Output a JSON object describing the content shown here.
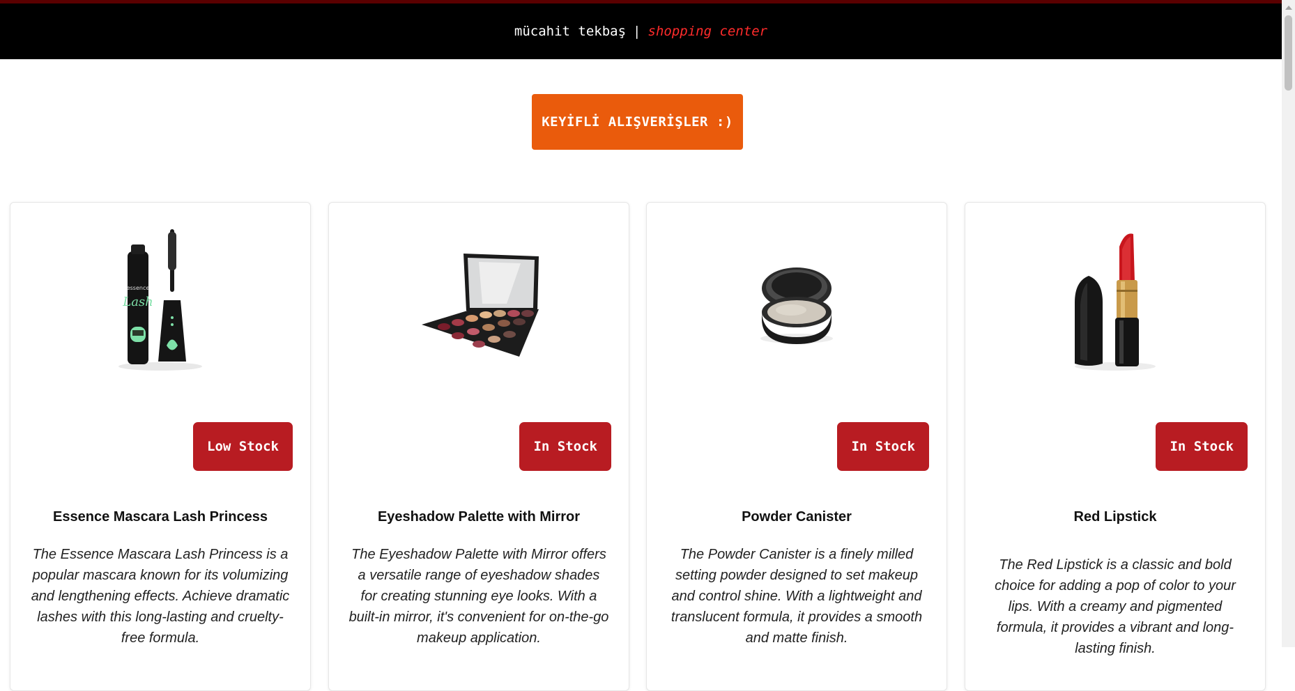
{
  "header": {
    "name": "mücahit tekbaş",
    "separator": "|",
    "subtitle": "shopping center"
  },
  "cta": {
    "label": "KEYİFLİ ALIŞVERİŞLER :)"
  },
  "products": [
    {
      "title": "Essence Mascara Lash Princess",
      "stock": "Low Stock",
      "description": "The Essence Mascara Lash Princess is a popular mascara known for its volumizing and lengthening effects. Achieve dramatic lashes with this long-lasting and cruelty-free formula.",
      "icon": "mascara-image"
    },
    {
      "title": "Eyeshadow Palette with Mirror",
      "stock": "In Stock",
      "description": "The Eyeshadow Palette with Mirror offers a versatile range of eyeshadow shades for creating stunning eye looks. With a built-in mirror, it's convenient for on-the-go makeup application.",
      "icon": "eyeshadow-palette-image"
    },
    {
      "title": "Powder Canister",
      "stock": "In Stock",
      "description": "The Powder Canister is a finely milled setting powder designed to set makeup and control shine. With a lightweight and translucent formula, it provides a smooth and matte finish.",
      "icon": "powder-canister-image"
    },
    {
      "title": "Red Lipstick",
      "stock": "In Stock",
      "description": "The Red Lipstick is a classic and bold choice for adding a pop of color to your lips. With a creamy and pigmented formula, it provides a vibrant and long-lasting finish.",
      "icon": "lipstick-image"
    }
  ],
  "colors": {
    "header_bg": "#000000",
    "subtitle": "#ff2b2b",
    "cta_bg": "#ea5b0c",
    "stock_badge": "#b81c22"
  }
}
